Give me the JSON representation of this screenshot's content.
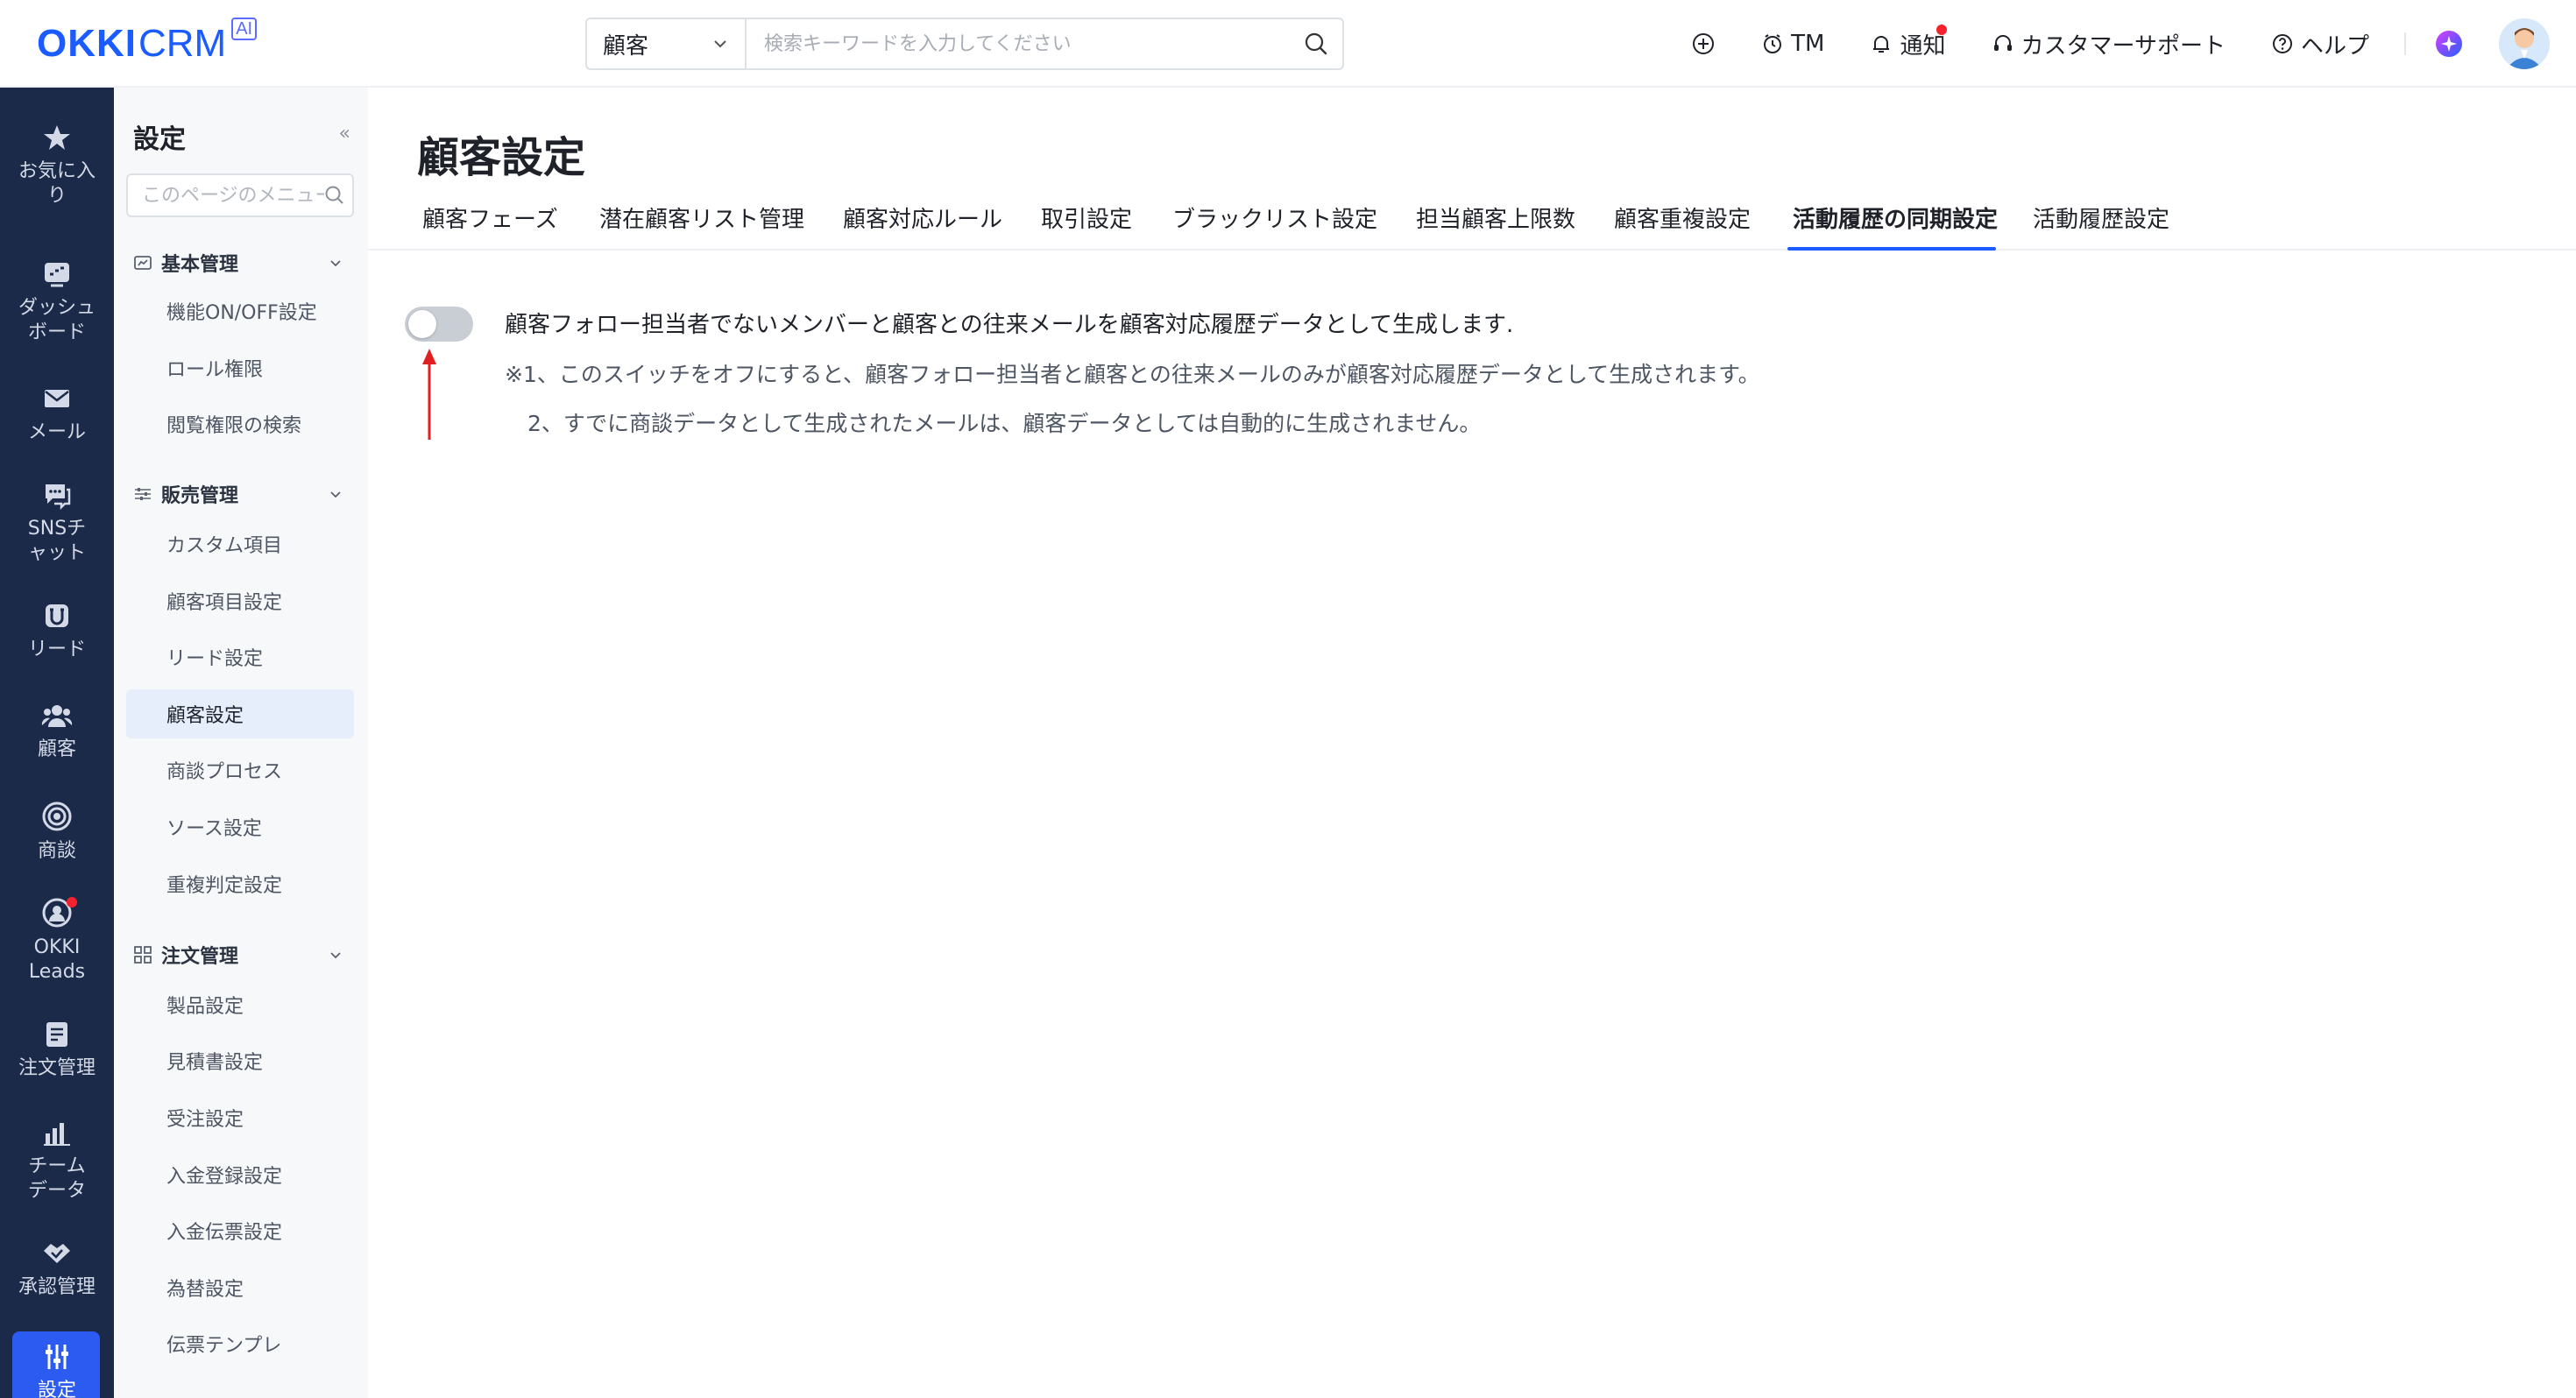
{
  "header": {
    "logo_main": "OKKI",
    "logo_sub": "CRM",
    "logo_badge": "AI",
    "search_scope": "顧客",
    "search_placeholder": "検索キーワードを入力してください",
    "nav": {
      "tm": "TM",
      "notify": "通知",
      "support": "カスタマーサポート",
      "help": "ヘルプ"
    }
  },
  "rail": {
    "items": [
      {
        "label": "お気に入り",
        "icon": "star-icon"
      },
      {
        "label": "ダッシュボード",
        "icon": "dashboard-icon"
      },
      {
        "label": "メール",
        "icon": "mail-icon"
      },
      {
        "label": "SNSチャット",
        "icon": "chat-icon"
      },
      {
        "label": "リード",
        "icon": "lead-icon"
      },
      {
        "label": "顧客",
        "icon": "customers-icon"
      },
      {
        "label": "商談",
        "icon": "target-icon"
      },
      {
        "label": "OKKI Leads",
        "icon": "okki-leads-icon"
      },
      {
        "label": "注文管理",
        "icon": "order-icon"
      },
      {
        "label": "チームデータ",
        "icon": "chart-icon"
      },
      {
        "label": "承認管理",
        "icon": "approval-icon"
      },
      {
        "label": "設定",
        "icon": "settings-icon"
      }
    ]
  },
  "menu": {
    "title": "設定",
    "search_placeholder": "このページのメニュー",
    "groups": [
      {
        "label": "基本管理",
        "items": [
          "機能ON/OFF設定",
          "ロール権限",
          "閲覧権限の検索"
        ]
      },
      {
        "label": "販売管理",
        "items": [
          "カスタム項目",
          "顧客項目設定",
          "リード設定",
          "顧客設定",
          "商談プロセス",
          "ソース設定",
          "重複判定設定"
        ]
      },
      {
        "label": "注文管理",
        "items": [
          "製品設定",
          "見積書設定",
          "受注設定",
          "入金登録設定",
          "入金伝票設定",
          "為替設定",
          "伝票テンプレ"
        ]
      }
    ],
    "active_item": "顧客設定"
  },
  "main": {
    "title": "顧客設定",
    "tabs": [
      "顧客フェーズ",
      "潜在顧客リスト管理",
      "顧客対応ルール",
      "取引設定",
      "ブラックリスト設定",
      "担当顧客上限数",
      "顧客重複設定",
      "活動履歴の同期設定",
      "活動履歴設定"
    ],
    "active_tab": "活動履歴の同期設定",
    "toggle_on": false,
    "description": "顧客フォロー担当者でないメンバーと顧客との往来メールを顧客対応履歴データとして生成します.",
    "note1": "※1、このスイッチをオフにすると、顧客フォロー担当者と顧客との往来メールのみが顧客対応履歴データとして生成されます。",
    "note2": "2、すでに商談データとして生成されたメールは、顧客データとしては自動的に生成されません。"
  },
  "colors": {
    "brand": "#1a5cff",
    "rail_bg": "#1c2a4a",
    "rail_active": "#2b5bf0",
    "toggle_off": "#c9cdd4",
    "arrow": "#e02020"
  }
}
